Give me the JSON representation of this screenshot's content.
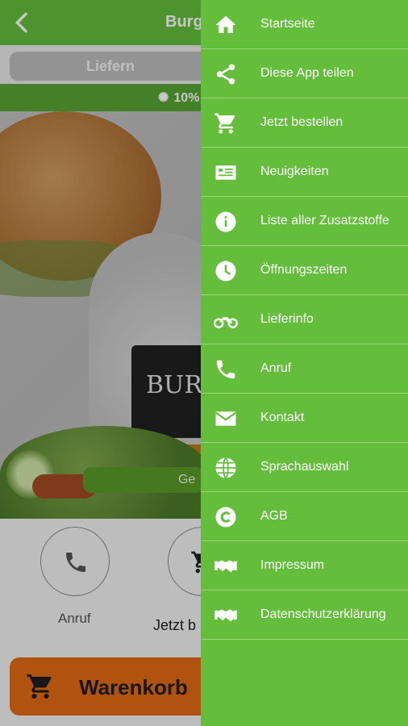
{
  "app": {
    "title": "Burge",
    "tab_deliver": "Liefern",
    "promo": "10%",
    "hero_button": "Ge",
    "logo_word": "BUR",
    "logo_sub": "BURGER"
  },
  "actions": {
    "call_label": "Anruf",
    "order_label": "Jetzt b"
  },
  "cart": {
    "label": "Warenkorb"
  },
  "drawer": {
    "items": [
      {
        "label": "Startseite",
        "icon": "home-icon"
      },
      {
        "label": "Diese App teilen",
        "icon": "share-icon"
      },
      {
        "label": "Jetzt bestellen",
        "icon": "cart-icon"
      },
      {
        "label": "Neuigkeiten",
        "icon": "news-icon"
      },
      {
        "label": "Liste aller Zusatzstoffe",
        "icon": "info-icon"
      },
      {
        "label": "Öffnungszeiten",
        "icon": "clock-icon"
      },
      {
        "label": "Lieferinfo",
        "icon": "motorcycle-icon"
      },
      {
        "label": "Anruf",
        "icon": "phone-icon"
      },
      {
        "label": "Kontakt",
        "icon": "mail-icon"
      },
      {
        "label": "Sprachauswahl",
        "icon": "globe-icon"
      },
      {
        "label": "AGB",
        "icon": "copyright-icon"
      },
      {
        "label": "Impressum",
        "icon": "handshake-icon"
      },
      {
        "label": "Datenschutzerklärung",
        "icon": "handshake-icon"
      }
    ]
  },
  "colors": {
    "primary_green": "#64be3c",
    "promo_green": "#58a432",
    "cart_orange": "#e16b12"
  }
}
